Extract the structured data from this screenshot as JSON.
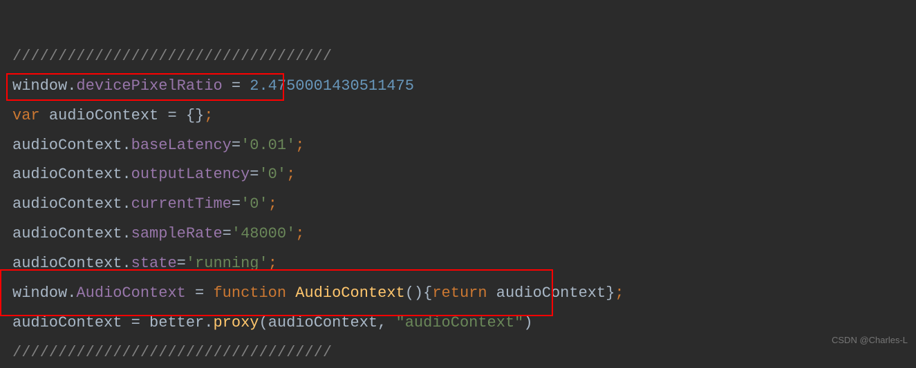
{
  "code": {
    "l1_comment": "///////////////////////////////////",
    "l2_window": "window",
    "l2_dot1": ".",
    "l2_devicePixelRatio": "devicePixelRatio",
    "l2_eq": " = ",
    "l2_value": "2.4750001430511475",
    "l3_var": "var",
    "l3_sp": " ",
    "l3_audioContext": "audioContext",
    "l3_eq": " = ",
    "l3_braces": "{}",
    "l3_semi": ";",
    "l4_audioContext": "audioContext",
    "l4_dot": ".",
    "l4_prop": "baseLatency",
    "l4_eq": "=",
    "l4_val": "'0.01'",
    "l4_semi": ";",
    "l5_audioContext": "audioContext",
    "l5_dot": ".",
    "l5_prop": "outputLatency",
    "l5_eq": "=",
    "l5_val": "'0'",
    "l5_semi": ";",
    "l6_audioContext": "audioContext",
    "l6_dot": ".",
    "l6_prop": "currentTime",
    "l6_eq": "=",
    "l6_val": "'0'",
    "l6_semi": ";",
    "l7_audioContext": "audioContext",
    "l7_dot": ".",
    "l7_prop": "sampleRate",
    "l7_eq": "=",
    "l7_val": "'48000'",
    "l7_semi": ";",
    "l8_audioContext": "audioContext",
    "l8_dot": ".",
    "l8_prop": "state",
    "l8_eq": "=",
    "l8_val": "'running'",
    "l8_semi": ";",
    "l9_window": "window",
    "l9_dot1": ".",
    "l9_AudioContext": "AudioContext",
    "l9_eq": " = ",
    "l9_function": "function",
    "l9_sp": " ",
    "l9_fnname": "AudioContext",
    "l9_parens": "()",
    "l9_lbrace": "{",
    "l9_return": "return",
    "l9_sp2": " ",
    "l9_retval": "audioContext",
    "l9_rbrace": "}",
    "l9_semi": ";",
    "l10_audioContext": "audioContext",
    "l10_eq": " = ",
    "l10_better": "better",
    "l10_dot": ".",
    "l10_proxy": "proxy",
    "l10_lp": "(",
    "l10_arg1": "audioContext",
    "l10_comma": ", ",
    "l10_arg2": "\"audioContext\"",
    "l10_rp": ")",
    "l11_comment": "///////////////////////////////////"
  },
  "watermark": "CSDN @Charles-L"
}
